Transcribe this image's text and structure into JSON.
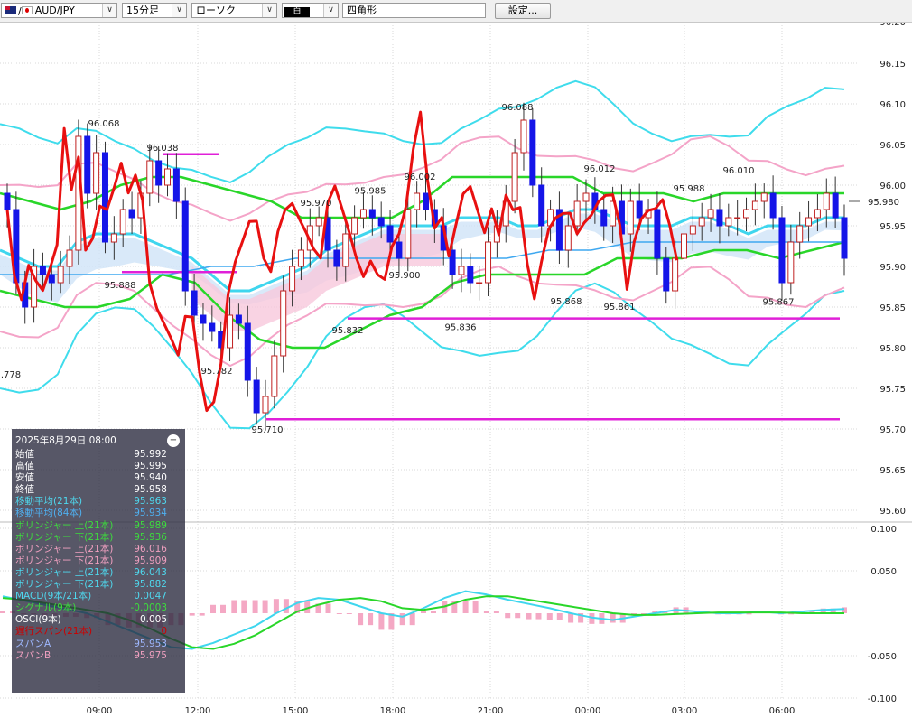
{
  "toolbar": {
    "pair": "AUD/JPY",
    "pair_prefix": "/",
    "timeframe": "15分足",
    "chart_type": "ローソク",
    "color_label": "白",
    "drawing_tool": "四角形",
    "settings_button": "設定...",
    "dropdown_glyph": "∨"
  },
  "info_panel": {
    "datetime": "2025年8月29日  08:00",
    "minimize_glyph": "−",
    "rows": [
      {
        "label": "始値",
        "value": "95.992",
        "color": "#ffffff"
      },
      {
        "label": "高値",
        "value": "95.995",
        "color": "#ffffff"
      },
      {
        "label": "安値",
        "value": "95.940",
        "color": "#ffffff"
      },
      {
        "label": "終値",
        "value": "95.958",
        "color": "#ffffff"
      },
      {
        "label": "移動平均(21本)",
        "value": "95.963",
        "color": "#4fd8ee"
      },
      {
        "label": "移動平均(84本)",
        "value": "95.934",
        "color": "#4fb0f0"
      },
      {
        "label": "ボリンジャー 上(21本)",
        "value": "95.989",
        "color": "#3ddc3d"
      },
      {
        "label": "ボリンジャー 下(21本)",
        "value": "95.936",
        "color": "#3ddc3d"
      },
      {
        "label": "ボリンジャー 上(21本)",
        "value": "96.016",
        "color": "#f0a0c0"
      },
      {
        "label": "ボリンジャー 下(21本)",
        "value": "95.909",
        "color": "#f0a0c0"
      },
      {
        "label": "ボリンジャー 上(21本)",
        "value": "96.043",
        "color": "#4fd8ee"
      },
      {
        "label": "ボリンジャー 下(21本)",
        "value": "95.882",
        "color": "#4fd8ee"
      },
      {
        "label": "MACD(9本/21本)",
        "value": "0.0047",
        "color": "#4fd8ee"
      },
      {
        "label": "シグナル(9本)",
        "value": "-0.0003",
        "color": "#3ddc3d"
      },
      {
        "label": "OSCI(9本)",
        "value": "0.005",
        "color": "#ffffff"
      },
      {
        "label": "遅行スパン(21本)",
        "value": "0",
        "color": "#cc0000"
      },
      {
        "label": "スパンA",
        "value": "95.953",
        "color": "#9fb8ff"
      },
      {
        "label": "スパンB",
        "value": "95.975",
        "color": "#f0a0c0"
      }
    ]
  },
  "chart_data": [
    {
      "type": "candlestick",
      "ylim": [
        95.6,
        96.2
      ],
      "y_ticks": [
        "96.15",
        "96.10",
        "96.05",
        "96.00",
        "95.95",
        "95.90",
        "95.85",
        "95.80",
        "95.75",
        "95.70",
        "95.65",
        "95.60"
      ],
      "current_price": "95.980",
      "x_ticks": [
        "09:00",
        "12:00",
        "15:00",
        "18:00",
        "21:00",
        "00:00",
        "03:00",
        "06:00"
      ],
      "annotations": [
        {
          "label": "96.068",
          "value": 96.068
        },
        {
          "label": "96.038",
          "value": 96.038
        },
        {
          "label": "95.888",
          "value": 95.888
        },
        {
          "label": "95.782",
          "value": 95.782
        },
        {
          "label": "95.710",
          "value": 95.71
        },
        {
          "label": "95.970",
          "value": 95.97
        },
        {
          "label": "95.985",
          "value": 95.985
        },
        {
          "label": "95.832",
          "value": 95.832
        },
        {
          "label": "96.002",
          "value": 96.002
        },
        {
          "label": "95.900",
          "value": 95.9
        },
        {
          "label": "95.836",
          "value": 95.836
        },
        {
          "label": "96.088",
          "value": 96.088
        },
        {
          "label": "96.012",
          "value": 96.012
        },
        {
          "label": "95.868",
          "value": 95.868
        },
        {
          "label": "95.861",
          "value": 95.861
        },
        {
          "label": "95.988",
          "value": 95.988
        },
        {
          "label": "96.010",
          "value": 96.01
        },
        {
          "label": "95.867",
          "value": 95.867
        },
        {
          "label": ".778",
          "value": 95.778
        }
      ],
      "horizontal_lines": [
        96.038,
        95.893,
        95.836,
        95.712
      ],
      "series": [
        {
          "legend": "close",
          "values": [
            95.97,
            95.88,
            95.85,
            95.9,
            95.89,
            95.88,
            95.9,
            95.92,
            96.06,
            95.99,
            96.04,
            95.93,
            95.94,
            95.97,
            95.96,
            95.99,
            96.03,
            96.0,
            96.02,
            95.98,
            95.87,
            95.84,
            95.83,
            95.82,
            95.8,
            95.84,
            95.83,
            95.76,
            95.72,
            95.74,
            95.79,
            95.87,
            95.9,
            95.92,
            95.95,
            95.96,
            95.92,
            95.9,
            95.94,
            95.96,
            95.97,
            95.96,
            95.95,
            95.93,
            95.91,
            95.97,
            95.99,
            95.97,
            95.95,
            95.92,
            95.89,
            95.9,
            95.88,
            95.88,
            95.93,
            95.95,
            95.98,
            96.04,
            96.08,
            96.0,
            95.95,
            95.97,
            95.92,
            95.95,
            95.98,
            95.99,
            95.97,
            95.95,
            95.98,
            95.94,
            95.98,
            95.96,
            95.97,
            95.91,
            95.87,
            95.91,
            95.94,
            95.95,
            95.96,
            95.97,
            95.95,
            95.96,
            95.96,
            95.97,
            95.98,
            95.99,
            95.96,
            95.88,
            95.93,
            95.95,
            95.96,
            95.97,
            95.99,
            95.96,
            95.91
          ]
        },
        {
          "legend": "MA21",
          "values": [
            95.92,
            95.91,
            95.9,
            95.9,
            95.93,
            95.94,
            95.94,
            95.94,
            95.93,
            95.92,
            95.91,
            95.89,
            95.87,
            95.87,
            95.88,
            95.89,
            95.9,
            95.92,
            95.93,
            95.94,
            95.95,
            95.95,
            95.95,
            95.95,
            95.96,
            95.96,
            95.96,
            95.95,
            95.95,
            95.96,
            95.97,
            95.97,
            95.96,
            95.95,
            95.95,
            95.95,
            95.96,
            95.96,
            95.95,
            95.94,
            95.95,
            95.95,
            95.95,
            95.96,
            95.96
          ]
        },
        {
          "legend": "MA84",
          "values": [
            95.89,
            95.89,
            95.89,
            95.89,
            95.89,
            95.9,
            95.9,
            95.91,
            95.91,
            95.91,
            95.91,
            95.91,
            95.91,
            95.92,
            95.92,
            95.93,
            95.93,
            95.93,
            95.93,
            95.93,
            95.93
          ]
        },
        {
          "legend": "BB1_upper",
          "values": [
            95.99,
            95.98,
            95.97,
            95.98,
            96.0,
            96.01,
            96.01,
            96.0,
            95.99,
            95.98,
            95.96,
            95.96,
            95.96,
            95.96,
            95.98,
            96.01,
            96.01,
            96.01,
            96.01,
            96.01,
            95.99,
            95.99,
            95.99,
            95.98,
            95.99,
            95.99,
            95.99,
            95.99,
            95.99
          ]
        },
        {
          "legend": "BB1_lower",
          "values": [
            95.87,
            95.86,
            95.85,
            95.85,
            95.86,
            95.89,
            95.88,
            95.84,
            95.81,
            95.8,
            95.8,
            95.82,
            95.84,
            95.85,
            95.88,
            95.89,
            95.89,
            95.89,
            95.89,
            95.91,
            95.91,
            95.91,
            95.92,
            95.92,
            95.91,
            95.92,
            95.93
          ]
        }
      ]
    },
    {
      "type": "macd",
      "ylim": [
        -0.1,
        0.1
      ],
      "y_ticks": [
        "0.100",
        "0.050",
        "-0.050",
        "-0.100"
      ],
      "series": [
        {
          "legend": "MACD",
          "values": [
            0.02,
            0.015,
            0.01,
            0.005,
            0.0,
            -0.01,
            -0.02,
            -0.03,
            -0.04,
            -0.042,
            -0.035,
            -0.025,
            -0.015,
            0.0,
            0.012,
            0.018,
            0.016,
            0.008,
            0.0,
            -0.004,
            0.006,
            0.018,
            0.026,
            0.022,
            0.016,
            0.011,
            0.006,
            0.0,
            -0.005,
            -0.008,
            -0.004,
            0.0,
            0.004,
            0.002,
            0.0,
            0.0,
            0.002,
            0.0,
            0.002,
            0.004,
            0.005
          ]
        },
        {
          "legend": "signal",
          "values": [
            0.018,
            0.016,
            0.012,
            0.008,
            0.004,
            0.0,
            -0.008,
            -0.018,
            -0.03,
            -0.04,
            -0.042,
            -0.036,
            -0.026,
            -0.012,
            0.002,
            0.01,
            0.016,
            0.018,
            0.014,
            0.006,
            0.004,
            0.008,
            0.016,
            0.02,
            0.02,
            0.016,
            0.012,
            0.008,
            0.004,
            0.0,
            -0.002,
            -0.002,
            -0.001,
            0.0,
            0.001,
            0.001,
            0.001,
            0.001,
            0.0,
            0.0,
            0.0
          ]
        }
      ]
    }
  ]
}
